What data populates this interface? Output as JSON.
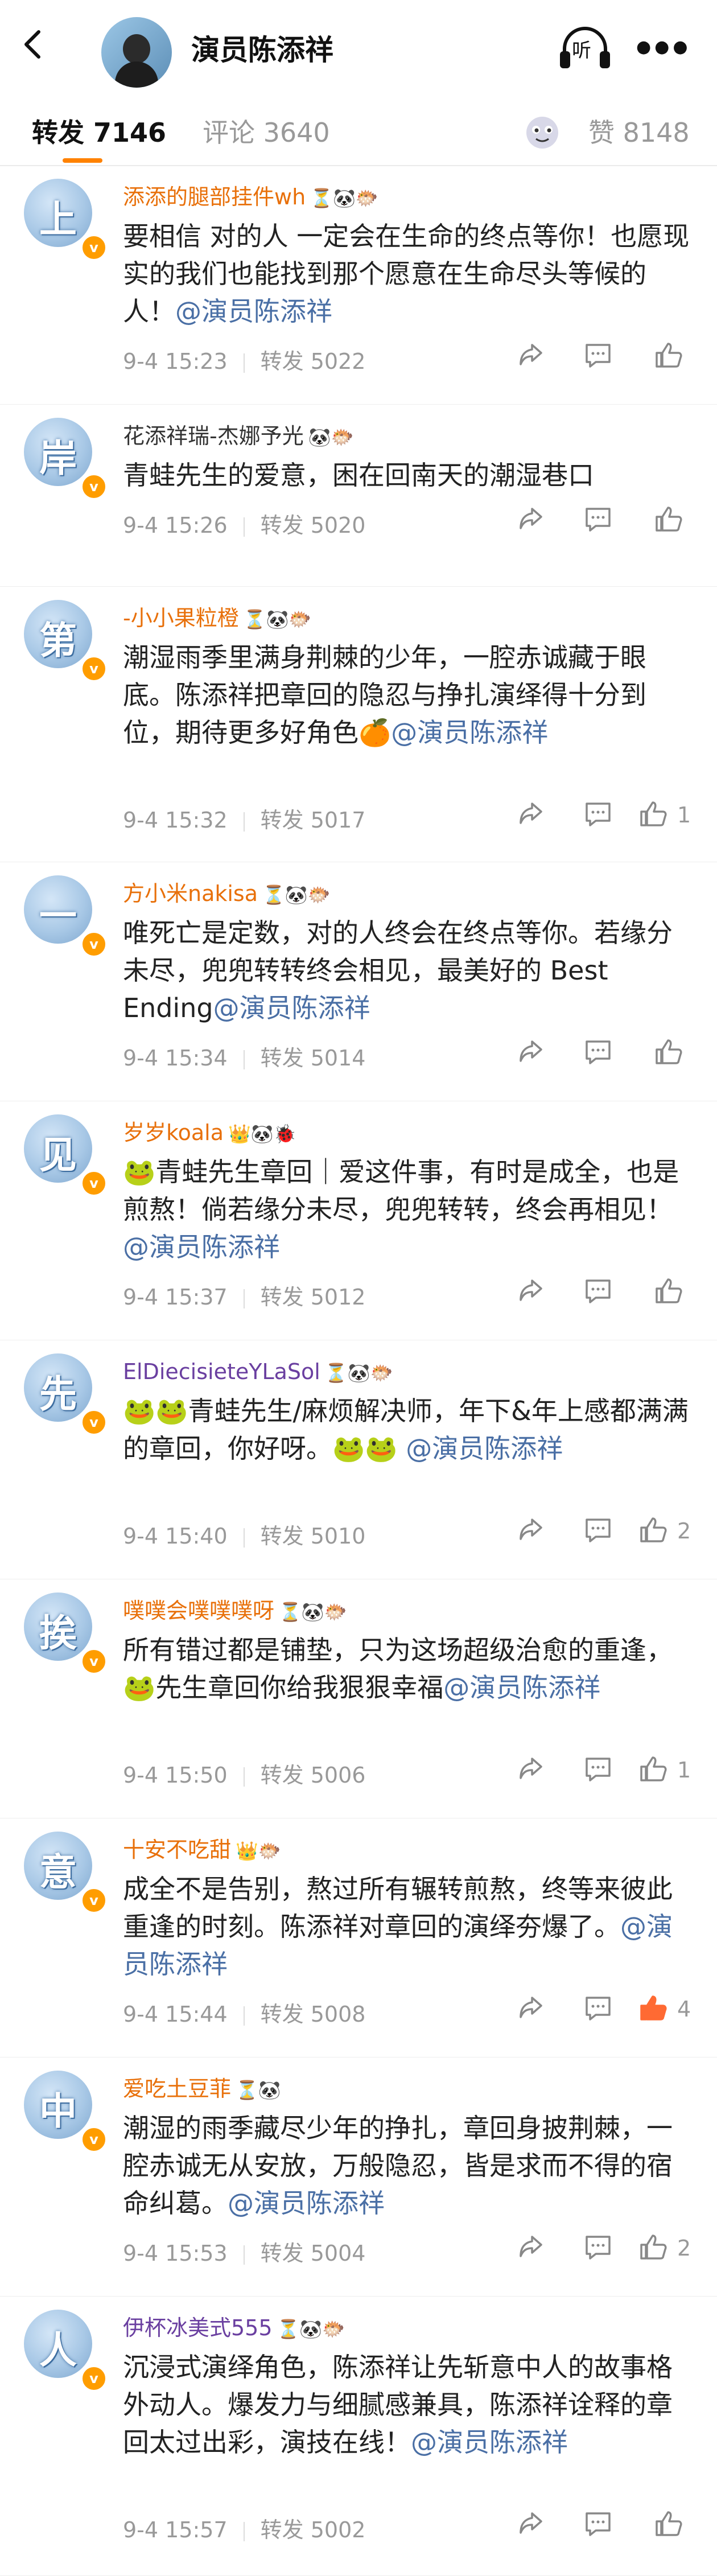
{
  "header": {
    "title": "演员陈添祥",
    "listen_label": "听"
  },
  "tabs": {
    "repost": "转发 7146",
    "comment": "评论 3640",
    "like": "赞 8148"
  },
  "colors": {
    "accent": "#ff8200",
    "mention": "#4a6fa5",
    "username_orange": "#e8700a",
    "username_purple": "#6a3fa0",
    "username_gray": "#333333",
    "like_active": "#ff6a33"
  },
  "reposts": [
    {
      "avatar_char": "上",
      "name": "添添的腿部挂件wh",
      "icons": "⏳🐼🐡",
      "text": "要相信 对的人 一定会在生命的终点等你！也愿现实的我们也能找到那个愿意在生命尽头等候的人！",
      "mention": "@演员陈添祥",
      "time": "9-4 15:23",
      "reposts": "转发 5022",
      "likes": ""
    },
    {
      "avatar_char": "岸",
      "name": "花添祥瑞-杰娜予光",
      "icons": "🐼🐡",
      "text": "青蛙先生的爱意，困在回南天的潮湿巷口",
      "mention": "",
      "time": "9-4 15:26",
      "reposts": "转发 5020",
      "likes": ""
    },
    {
      "avatar_char": "第",
      "name": "-小小果粒橙",
      "icons": "⏳🐼🐡",
      "text": "潮湿雨季里满身荆棘的少年，一腔赤诚藏于眼底。陈添祥把章回的隐忍与挣扎演绎得十分到位，期待更多好角色🍊",
      "mention": "@演员陈添祥",
      "time": "9-4 15:32",
      "reposts": "转发 5017",
      "likes": "1"
    },
    {
      "avatar_char": "一",
      "name": "方小米nakisa",
      "icons": "⏳🐼🐡",
      "text": "唯死亡是定数，对的人终会在终点等你。若缘分未尽，兜兜转转终会相见，最美好的 Best Ending",
      "mention": "@演员陈添祥",
      "time": "9-4 15:34",
      "reposts": "转发 5014",
      "likes": ""
    },
    {
      "avatar_char": "见",
      "name": "岁岁koala",
      "icons": "👑🐼🐞",
      "text": "🐸青蛙先生章回｜爱这件事，有时是成全，也是煎熬！倘若缘分未尽，兜兜转转，终会再相见！",
      "mention": "@演员陈添祥",
      "time": "9-4 15:37",
      "reposts": "转发 5012",
      "likes": ""
    },
    {
      "avatar_char": "先",
      "name": "ElDiecisieteYLaSol",
      "icons": "⏳🐼🐡",
      "text": "🐸🐸青蛙先生/麻烦解决师，年下&年上感都满满的章回，你好呀。🐸🐸 ",
      "mention": "@演员陈添祥",
      "time": "9-4 15:40",
      "reposts": "转发 5010",
      "likes": "2"
    },
    {
      "avatar_char": "挨",
      "name": "噗噗会噗噗噗呀",
      "icons": "⏳🐼🐡",
      "text": " 所有错过都是铺垫，只为这场超级治愈的重逢，🐸先生章回你给我狠狠幸福",
      "mention": "@演员陈添祥",
      "time": "9-4 15:50",
      "reposts": "转发 5006",
      "likes": "1"
    },
    {
      "avatar_char": "意",
      "name": "十安不吃甜",
      "icons": "👑🐡",
      "text": "成全不是告别，熬过所有辗转煎熬，终等来彼此重逢的时刻。陈添祥对章回的演绎夯爆了。",
      "mention": "@演员陈添祥",
      "time": "9-4 15:44",
      "reposts": "转发 5008",
      "likes": "4"
    },
    {
      "avatar_char": "中",
      "name": "爱吃土豆菲",
      "icons": "⏳🐼",
      "text": "潮湿的雨季藏尽少年的挣扎，章回身披荆棘，一腔赤诚无从安放，万般隐忍，皆是求而不得的宿命纠葛。",
      "mention": "@演员陈添祥",
      "time": "9-4 15:53",
      "reposts": "转发 5004",
      "likes": "2"
    },
    {
      "avatar_char": "人",
      "name": "伊杯冰美式555",
      "icons": "⏳🐼🐡",
      "text": "沉浸式演绎角色，陈添祥让先斩意中人的故事格外动人。爆发力与细腻感兼具，陈添祥诠释的章回太过出彩，演技在线！",
      "mention": "@演员陈添祥",
      "time": "9-4 15:57",
      "reposts": "转发 5002",
      "likes": ""
    }
  ]
}
